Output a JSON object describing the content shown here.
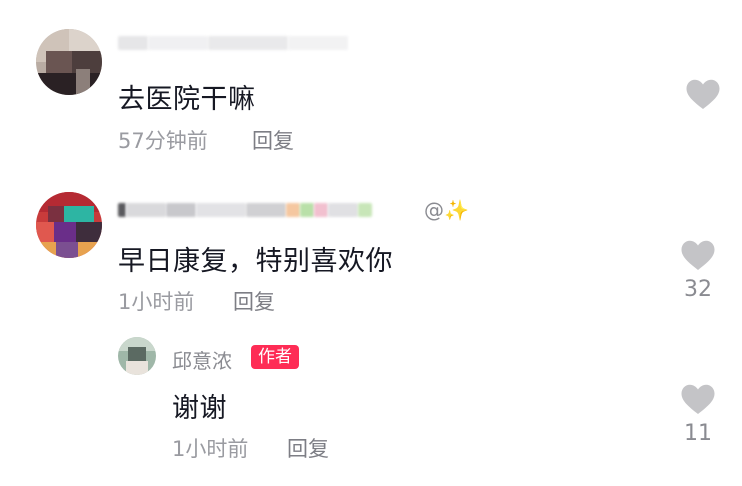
{
  "comments": [
    {
      "username": "",
      "text": "去医院干嘛",
      "time": "57分钟前",
      "reply_label": "回复",
      "like_count": ""
    },
    {
      "username_suffix": "@✨",
      "text": "早日康复，特别喜欢你",
      "time": "1小时前",
      "reply_label": "回复",
      "like_count": "32"
    },
    {
      "username": "邱意浓",
      "author_badge": "作者",
      "text": "谢谢",
      "time": "1小时前",
      "reply_label": "回复",
      "like_count": "11"
    }
  ],
  "colors": {
    "author_badge": "#fe2c55",
    "heart": "#c4c4c7",
    "meta": "#9a9ba1"
  },
  "icons": [
    "heart-icon",
    "sparkle-icon"
  ]
}
